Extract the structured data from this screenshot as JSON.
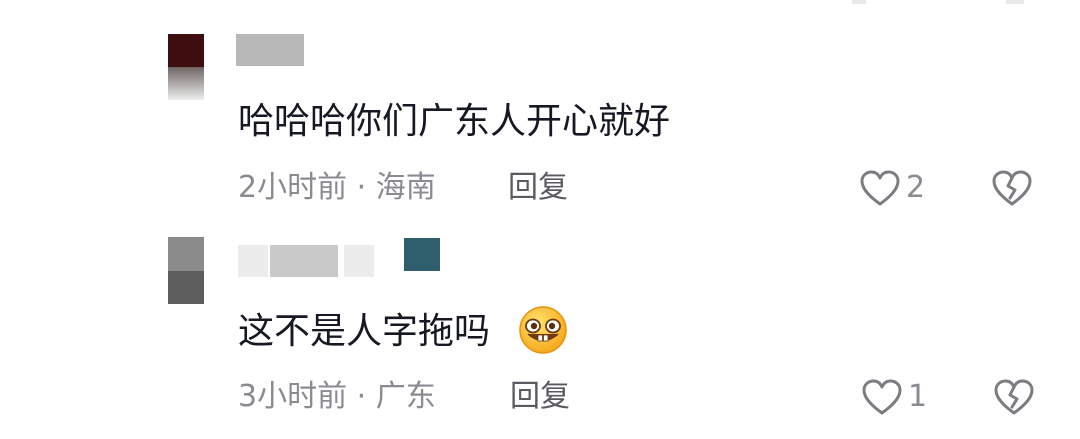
{
  "comments": [
    {
      "text": "哈哈哈你们广东人开心就好",
      "meta": "2小时前 · 海南",
      "reply_label": "回复",
      "likes": "2",
      "like_icon": "heart-outline-icon",
      "dislike_icon": "broken-heart-icon"
    },
    {
      "text": "这不是人字拖吗",
      "emoji": "grinning-buck-teeth-emoji",
      "meta": "3小时前 · 广东",
      "reply_label": "回复",
      "likes": "1",
      "like_icon": "heart-outline-icon",
      "dislike_icon": "broken-heart-icon"
    }
  ],
  "colors": {
    "text": "#161823",
    "meta": "#8a8b91",
    "reply": "#5a5b61",
    "icon": "#7c7d82"
  }
}
